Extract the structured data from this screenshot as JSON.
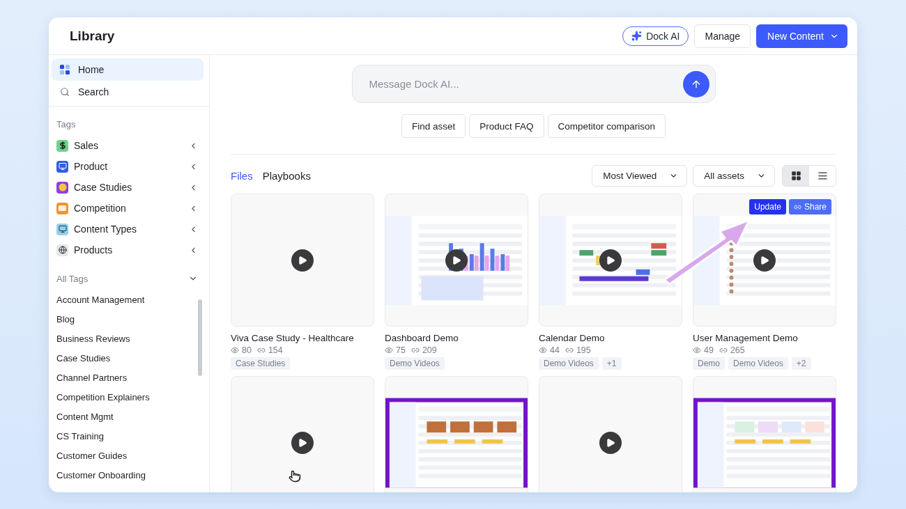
{
  "header": {
    "title": "Library",
    "dock_ai_button": "Dock AI",
    "manage_button": "Manage",
    "new_content_button": "New Content"
  },
  "sidebar": {
    "nav": [
      {
        "label": "Home",
        "kind": "home",
        "selected": true
      },
      {
        "label": "Search",
        "kind": "search",
        "selected": false
      }
    ],
    "tags_heading": "Tags",
    "tags": [
      {
        "label": "Sales",
        "kind": "dollar"
      },
      {
        "label": "Product",
        "kind": "monitor"
      },
      {
        "label": "Case Studies",
        "kind": "smiley"
      },
      {
        "label": "Competition",
        "kind": "versus"
      },
      {
        "label": "Content Types",
        "kind": "computer"
      },
      {
        "label": "Products",
        "kind": "globe"
      }
    ],
    "all_tags": {
      "label": "All Tags",
      "expanded": true
    },
    "all_tags_items": [
      "Account Management",
      "Blog",
      "Business Reviews",
      "Case Studies",
      "Channel Partners",
      "Competition Explainers",
      "Content Mgmt",
      "CS Training",
      "Customer Guides",
      "Customer Onboarding"
    ]
  },
  "chat": {
    "placeholder": "Message Dock AI...",
    "suggestions": [
      "Find asset",
      "Product FAQ",
      "Competitor comparison"
    ]
  },
  "tabs": [
    {
      "label": "Files",
      "selected": true
    },
    {
      "label": "Playbooks",
      "selected": false
    }
  ],
  "sort_dropdown": "Most Viewed",
  "filter_dropdown": "All assets",
  "view_toggle": [
    {
      "kind": "grid",
      "selected": true
    },
    {
      "kind": "list",
      "selected": false
    }
  ],
  "cards": [
    {
      "title": "Viva Case Study - Healthcare",
      "views": "80",
      "links": "154",
      "tags": [
        "Case Studies"
      ],
      "kind": "none",
      "video": true
    },
    {
      "title": "Dashboard Demo",
      "views": "75",
      "links": "209",
      "tags": [
        "Demo Videos"
      ],
      "kind": "dashboard",
      "video": true
    },
    {
      "title": "Calendar Demo",
      "views": "44",
      "links": "195",
      "tags": [
        "Demo Videos",
        "+1"
      ],
      "kind": "calendar",
      "video": true
    },
    {
      "title": "User Management Demo",
      "views": "49",
      "links": "265",
      "tags": [
        "Demo",
        "Demo Videos",
        "+2"
      ],
      "kind": "users",
      "video": true,
      "actions": [
        "Update",
        "Share"
      ]
    },
    {
      "kind": "none",
      "video": true
    },
    {
      "kind": "teams",
      "video": false
    },
    {
      "kind": "none",
      "video": true
    },
    {
      "kind": "files",
      "video": false
    }
  ]
}
